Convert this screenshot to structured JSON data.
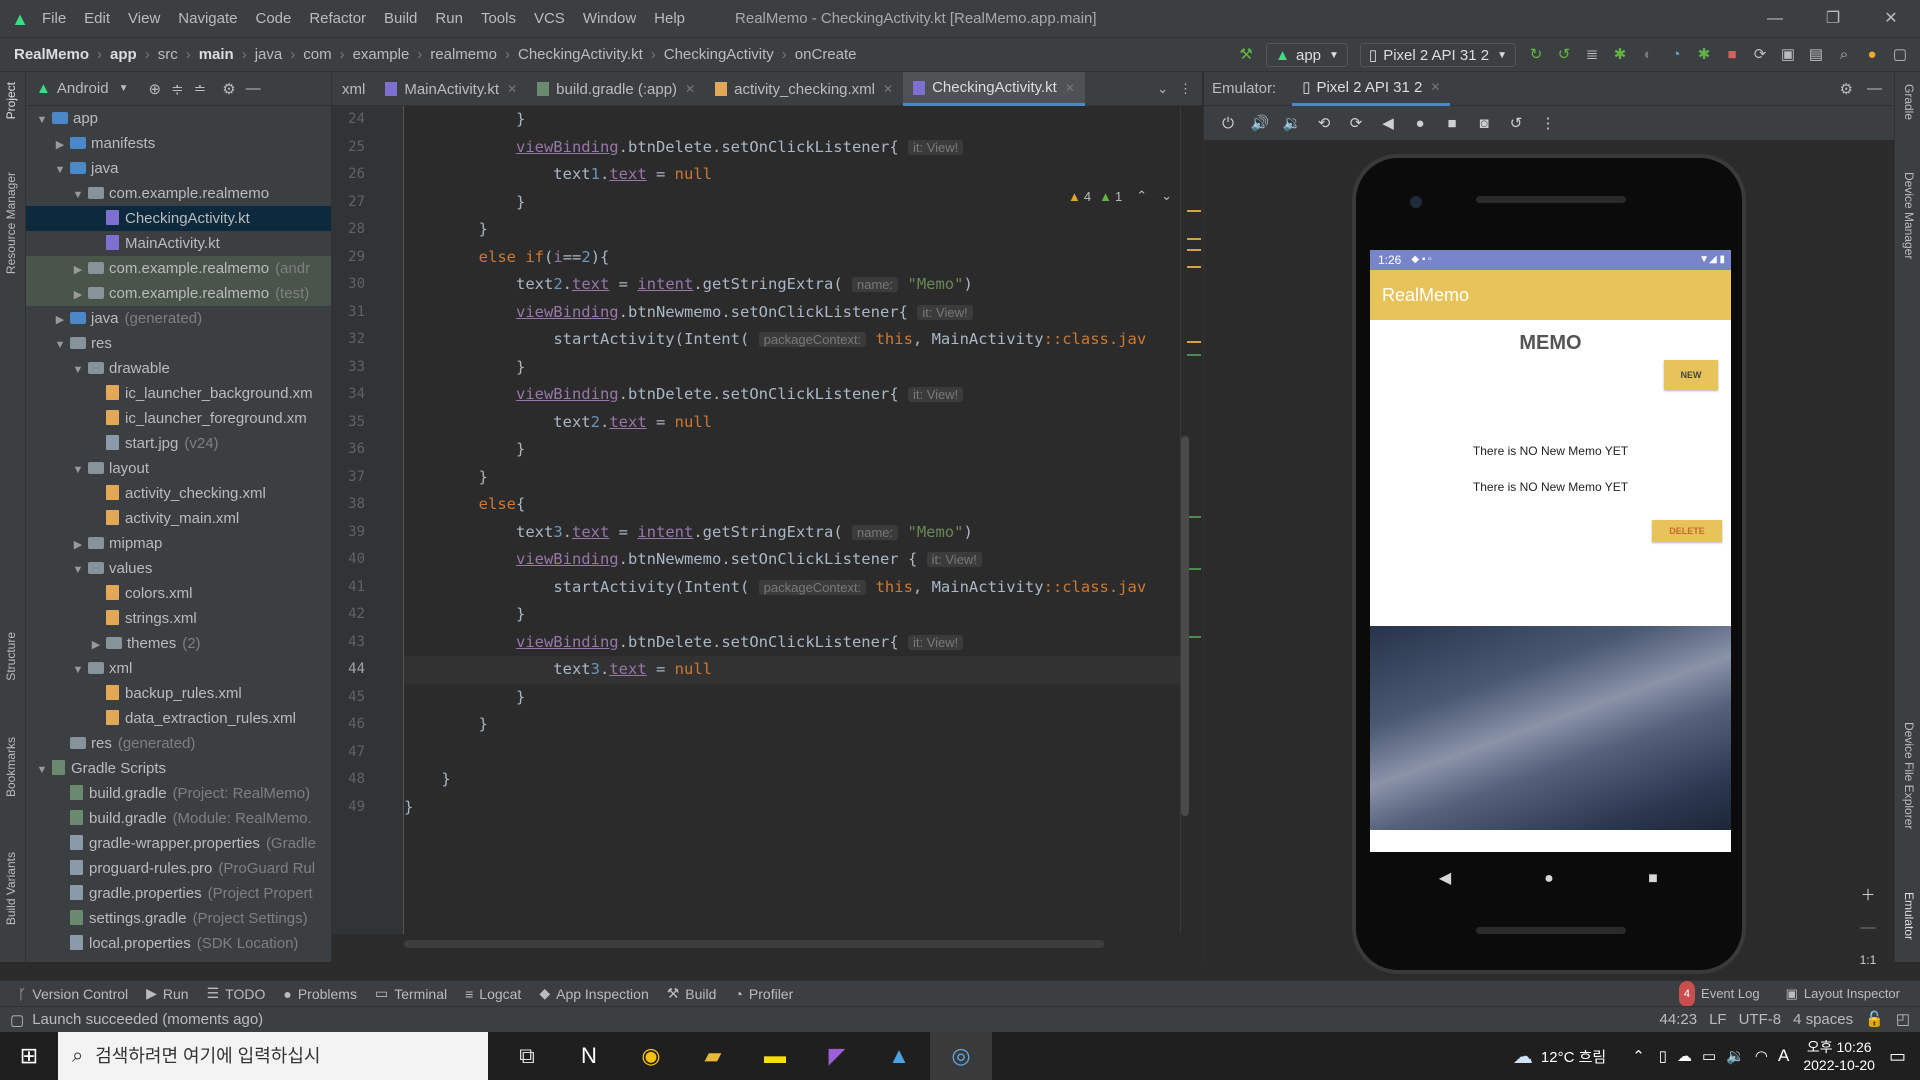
{
  "window": {
    "title": "RealMemo - CheckingActivity.kt [RealMemo.app.main]",
    "menu": [
      "File",
      "Edit",
      "View",
      "Navigate",
      "Code",
      "Refactor",
      "Build",
      "Run",
      "Tools",
      "VCS",
      "Window",
      "Help"
    ]
  },
  "breadcrumb": [
    "RealMemo",
    "app",
    "src",
    "main",
    "java",
    "com",
    "example",
    "realmemo",
    "CheckingActivity.kt",
    "CheckingActivity",
    "onCreate"
  ],
  "run_config": "app",
  "device_select": "Pixel 2 API 31 2",
  "project": {
    "view_mode": "Android",
    "tree": [
      {
        "label": "app",
        "hint": "",
        "depth": 0,
        "kind": "folder-blue",
        "arrow": "▼"
      },
      {
        "label": "manifests",
        "hint": "",
        "depth": 1,
        "kind": "folder-blue",
        "arrow": "▶"
      },
      {
        "label": "java",
        "hint": "",
        "depth": 1,
        "kind": "folder-blue",
        "arrow": "▼"
      },
      {
        "label": "com.example.realmemo",
        "hint": "",
        "depth": 2,
        "kind": "folder",
        "arrow": "▼"
      },
      {
        "label": "CheckingActivity.kt",
        "hint": "",
        "depth": 3,
        "kind": "kt",
        "arrow": "",
        "selected": true
      },
      {
        "label": "MainActivity.kt",
        "hint": "",
        "depth": 3,
        "kind": "kt",
        "arrow": ""
      },
      {
        "label": "com.example.realmemo",
        "hint": "(andr",
        "depth": 2,
        "kind": "folder",
        "arrow": "▶",
        "modhl": true
      },
      {
        "label": "com.example.realmemo",
        "hint": "(test)",
        "depth": 2,
        "kind": "folder",
        "arrow": "▶",
        "modhl": true
      },
      {
        "label": "java",
        "hint": "(generated)",
        "depth": 1,
        "kind": "folder-blue",
        "arrow": "▶"
      },
      {
        "label": "res",
        "hint": "",
        "depth": 1,
        "kind": "folder",
        "arrow": "▼"
      },
      {
        "label": "drawable",
        "hint": "",
        "depth": 2,
        "kind": "folder",
        "arrow": "▼"
      },
      {
        "label": "ic_launcher_background.xm",
        "hint": "",
        "depth": 3,
        "kind": "xml",
        "arrow": ""
      },
      {
        "label": "ic_launcher_foreground.xm",
        "hint": "",
        "depth": 3,
        "kind": "xml",
        "arrow": ""
      },
      {
        "label": "start.jpg",
        "hint": "(v24)",
        "depth": 3,
        "kind": "img",
        "arrow": ""
      },
      {
        "label": "layout",
        "hint": "",
        "depth": 2,
        "kind": "folder",
        "arrow": "▼"
      },
      {
        "label": "activity_checking.xml",
        "hint": "",
        "depth": 3,
        "kind": "xml",
        "arrow": ""
      },
      {
        "label": "activity_main.xml",
        "hint": "",
        "depth": 3,
        "kind": "xml",
        "arrow": ""
      },
      {
        "label": "mipmap",
        "hint": "",
        "depth": 2,
        "kind": "folder",
        "arrow": "▶"
      },
      {
        "label": "values",
        "hint": "",
        "depth": 2,
        "kind": "folder",
        "arrow": "▼"
      },
      {
        "label": "colors.xml",
        "hint": "",
        "depth": 3,
        "kind": "xml",
        "arrow": ""
      },
      {
        "label": "strings.xml",
        "hint": "",
        "depth": 3,
        "kind": "xml",
        "arrow": ""
      },
      {
        "label": "themes",
        "hint": "(2)",
        "depth": 3,
        "kind": "folder",
        "arrow": "▶"
      },
      {
        "label": "xml",
        "hint": "",
        "depth": 2,
        "kind": "folder",
        "arrow": "▼"
      },
      {
        "label": "backup_rules.xml",
        "hint": "",
        "depth": 3,
        "kind": "xml",
        "arrow": ""
      },
      {
        "label": "data_extraction_rules.xml",
        "hint": "",
        "depth": 3,
        "kind": "xml",
        "arrow": ""
      },
      {
        "label": "res",
        "hint": "(generated)",
        "depth": 1,
        "kind": "folder",
        "arrow": ""
      },
      {
        "label": "Gradle Scripts",
        "hint": "",
        "depth": 0,
        "kind": "gradle",
        "arrow": "▼"
      },
      {
        "label": "build.gradle",
        "hint": "(Project: RealMemo)",
        "depth": 1,
        "kind": "gradle",
        "arrow": ""
      },
      {
        "label": "build.gradle",
        "hint": "(Module: RealMemo.",
        "depth": 1,
        "kind": "gradle",
        "arrow": ""
      },
      {
        "label": "gradle-wrapper.properties",
        "hint": "(Gradle",
        "depth": 1,
        "kind": "file",
        "arrow": ""
      },
      {
        "label": "proguard-rules.pro",
        "hint": "(ProGuard Rul",
        "depth": 1,
        "kind": "file",
        "arrow": ""
      },
      {
        "label": "gradle.properties",
        "hint": "(Project Propert",
        "depth": 1,
        "kind": "file",
        "arrow": ""
      },
      {
        "label": "settings.gradle",
        "hint": "(Project Settings)",
        "depth": 1,
        "kind": "gradle",
        "arrow": ""
      },
      {
        "label": "local.properties",
        "hint": "(SDK Location)",
        "depth": 1,
        "kind": "file",
        "arrow": ""
      }
    ]
  },
  "editor": {
    "tabs": [
      {
        "label": "xml",
        "active": false
      },
      {
        "label": "MainActivity.kt",
        "active": false
      },
      {
        "label": "build.gradle (:app)",
        "active": false
      },
      {
        "label": "activity_checking.xml",
        "active": false
      },
      {
        "label": "CheckingActivity.kt",
        "active": true
      }
    ],
    "inspections": {
      "warnings": "4",
      "weak": "1"
    },
    "first_line": 24,
    "current_line": 44,
    "lines": [
      "            }",
      "            viewBinding.btnDelete.setOnClickListener{ ⟦it: View!⟧",
      "                text1.text = null",
      "            }",
      "        }",
      "        else if(i==2){",
      "            text2.text = intent.getStringExtra( ⟦name:⟧ \"Memo\")",
      "            viewBinding.btnNewmemo.setOnClickListener{ ⟦it: View!⟧",
      "                startActivity(Intent( ⟦packageContext:⟧ this, MainActivity::class.jav",
      "            }",
      "            viewBinding.btnDelete.setOnClickListener{ ⟦it: View!⟧",
      "                text2.text = null",
      "            }",
      "        }",
      "        else{",
      "            text3.text = intent.getStringExtra( ⟦name:⟧ \"Memo\")",
      "            viewBinding.btnNewmemo.setOnClickListener { ⟦it: View!⟧",
      "                startActivity(Intent( ⟦packageContext:⟧ this, MainActivity::class.jav",
      "            }",
      "            viewBinding.btnDelete.setOnClickListener{ ⟦it: View!⟧",
      "                text3.text = null",
      "            }",
      "        }",
      "",
      "    }",
      "}"
    ]
  },
  "emulator": {
    "label": "Emulator:",
    "device_tab": "Pixel 2 API 31 2",
    "phone": {
      "status_time": "1:26",
      "app_title": "RealMemo",
      "heading": "MEMO",
      "new_button": "NEW",
      "memo1": "There is NO New Memo YET",
      "memo2": "There is NO New Memo YET",
      "delete_button": "DELETE"
    },
    "zoom_ratio": "1:1"
  },
  "tool_windows": [
    "Version Control",
    "Run",
    "TODO",
    "Problems",
    "Terminal",
    "Logcat",
    "App Inspection",
    "Build",
    "Profiler"
  ],
  "event_log": {
    "count": "4",
    "label": "Event Log"
  },
  "layout_inspector": "Layout Inspector",
  "left_strip": [
    "Project",
    "Resource Manager",
    "Structure",
    "Bookmarks",
    "Build Variants"
  ],
  "right_strip": [
    "Gradle",
    "Device Manager",
    "Device File Explorer",
    "Emulator"
  ],
  "status": {
    "message": "Launch succeeded (moments ago)",
    "position": "44:23",
    "line_sep": "LF",
    "encoding": "UTF-8",
    "indent": "4 spaces"
  },
  "taskbar": {
    "search_placeholder": "검색하려면 여기에 입력하십시",
    "weather": "12°C 흐림",
    "ime": "A",
    "time": "오후 10:26",
    "date": "2022-10-20"
  }
}
